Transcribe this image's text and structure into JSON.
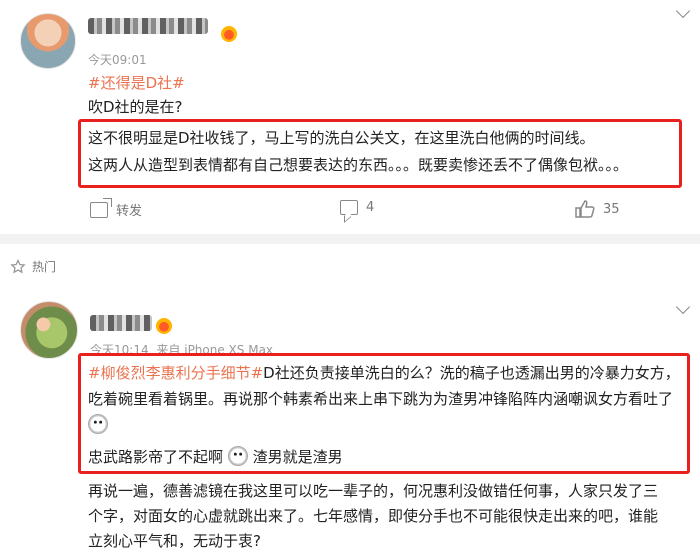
{
  "post1": {
    "time": "今天09:01",
    "topic": "#还得是D社#",
    "line1": "吹D社的是在?",
    "boxed_lines": [
      "这不很明显是D社收钱了，马上写的洗白公关文，在这里洗白他俩的时间线。",
      "这两人从造型到表情都有自己想要表达的东西。。。既要卖惨还丢不了偶像包袱。。。"
    ],
    "actions": {
      "share_label": "转发",
      "comment_count": "4",
      "like_count": "35"
    }
  },
  "hot_section": {
    "label": "热门"
  },
  "post2": {
    "time": "今天10:14",
    "source": "来自 iPhone XS Max",
    "boxed": {
      "topic": "#柳俊烈李惠利分手细节#",
      "text_after_topic": "D社还负责接单洗白的么？洗的稿子也透漏出男的冷暴力女方，吃着碗里看着锅里。再说那个韩素希出来上串下跳为为渣男冲锋陷阵内涵嘲讽女方看吐了",
      "line2_part1": "忠武路影帝了不起啊",
      "line2_part2": "渣男就是渣男"
    },
    "after_box": [
      "再说一遍，德善滤镜在我这里可以吃一辈子的，何况惠利没做错任何事，人家只发了三",
      "个字，对面女的心虚就跳出来了。七年感情，即使分手也不可能很快走出来的吧，谁能",
      "立刻心平气和，无动于衷?"
    ]
  },
  "colors": {
    "accent_orange": "#eb7350",
    "highlight_red": "#e8211e",
    "muted": "#999999"
  }
}
